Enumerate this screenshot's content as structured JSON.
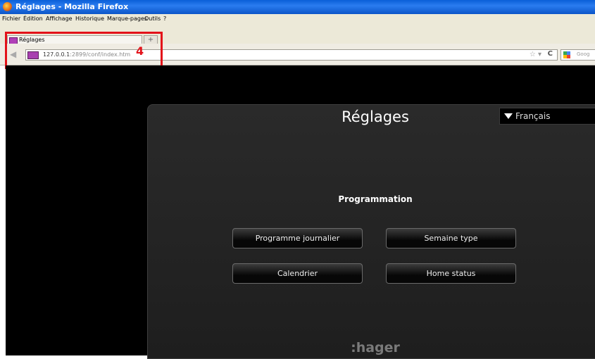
{
  "window": {
    "title": "Réglages - Mozilla Firefox"
  },
  "menu": {
    "items": [
      "Fichier",
      "Édition",
      "Affichage",
      "Historique",
      "Marque-pages",
      "Outils",
      "?"
    ]
  },
  "tab": {
    "label": "Réglages",
    "new_tab": "+"
  },
  "navbar": {
    "url_host": "127.0.0.1",
    "url_path": ":2899/conf/index.htm",
    "search_placeholder": "Goog"
  },
  "annotation": {
    "number": "4",
    "color": "#e3121a"
  },
  "page": {
    "title": "Réglages",
    "language": "Français",
    "section": "Programmation",
    "buttons": [
      "Programme journalier",
      "Semaine type",
      "Calendrier",
      "Home status"
    ],
    "logo": ":hager"
  }
}
